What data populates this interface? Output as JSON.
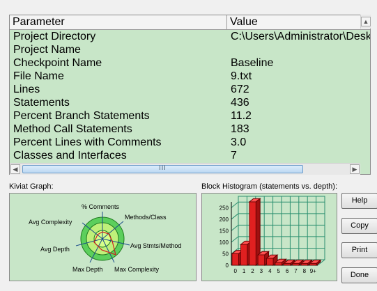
{
  "table": {
    "columns": [
      "Parameter",
      "Value"
    ],
    "rows": [
      {
        "parameter": "Project Directory",
        "value": "C:\\Users\\Administrator\\Desk"
      },
      {
        "parameter": "Project Name",
        "value": ""
      },
      {
        "parameter": "Checkpoint Name",
        "value": "Baseline"
      },
      {
        "parameter": "File Name",
        "value": "9.txt"
      },
      {
        "parameter": "Lines",
        "value": "672"
      },
      {
        "parameter": "Statements",
        "value": "436"
      },
      {
        "parameter": "Percent Branch Statements",
        "value": "11.2"
      },
      {
        "parameter": "Method Call Statements",
        "value": "183"
      },
      {
        "parameter": "Percent Lines with Comments",
        "value": "3.0"
      },
      {
        "parameter": "Classes and Interfaces",
        "value": "7"
      }
    ]
  },
  "kiviat": {
    "caption": "Kiviat Graph:",
    "axes": [
      "% Comments",
      "Methods/Class",
      "Avg Stmts/Method",
      "Max Complexity",
      "Max Depth",
      "Avg Depth",
      "Avg Complexity"
    ]
  },
  "histogram": {
    "caption": "Block Histogram (statements vs. depth):"
  },
  "buttons": {
    "help": "Help",
    "copy": "Copy",
    "print": "Print",
    "done": "Done"
  },
  "icons": {
    "scroll_left": "arrow-left-icon",
    "scroll_right": "arrow-right-icon",
    "scroll_up": "arrow-up-icon"
  },
  "colors": {
    "panel_bg": "#c8e6c8",
    "bar_fill": "#e02020",
    "grid": "#2b8f6f",
    "kiviat_fill": "#bff07a"
  },
  "chart_data": {
    "type": "bar",
    "categories": [
      "0",
      "1",
      "2",
      "3",
      "4",
      "5",
      "6",
      "7",
      "8",
      "9+"
    ],
    "values": [
      50,
      90,
      275,
      45,
      30,
      12,
      8,
      8,
      8,
      8
    ],
    "ylim": [
      0,
      275
    ],
    "yticks": [
      0,
      50,
      100,
      150,
      200,
      250
    ],
    "grid": true
  }
}
